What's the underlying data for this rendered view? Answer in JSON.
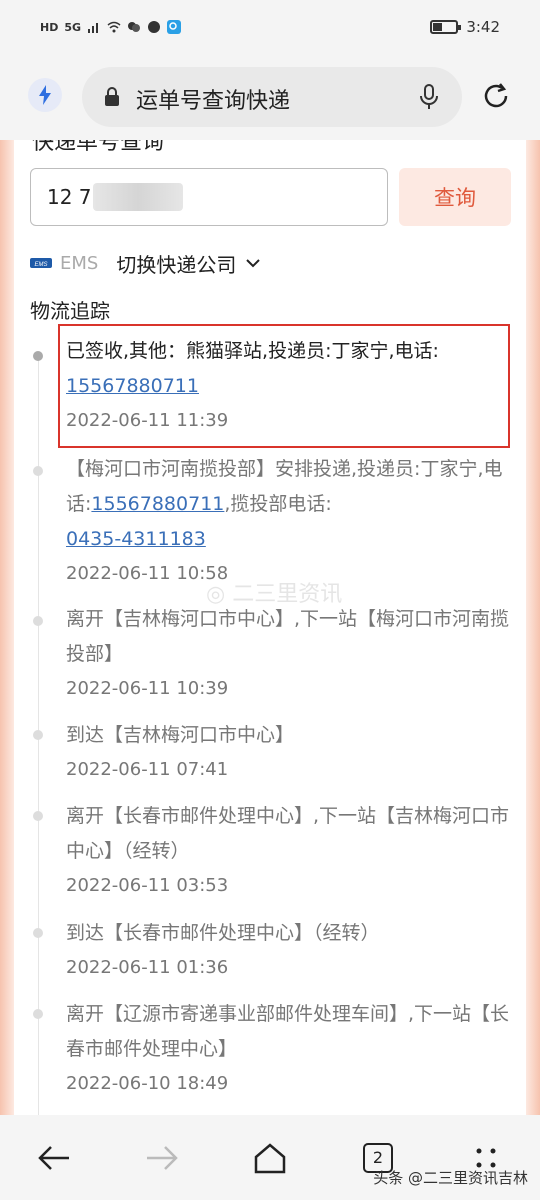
{
  "status_bar": {
    "network": "5G",
    "time": "3:42"
  },
  "browser": {
    "address_text": "运单号查询快递"
  },
  "page": {
    "cut_title": "快递单号查询",
    "tracking_number": "12        7760",
    "query_label": "查询",
    "carrier_name": "EMS",
    "carrier_logo_text": "EMS",
    "switch_carrier_label": "切换快递公司",
    "section_title": "物流追踪",
    "watermark": "◎ 二三里资讯"
  },
  "events": [
    {
      "text_before": "已签收,其他：熊猫驿站,投递员:丁家宁,电话:",
      "phone": "15567880711",
      "text_after": "",
      "time": "2022-06-11 11:39"
    },
    {
      "text_before": "【梅河口市河南揽投部】安排投递,投递员:丁家宁,电话:",
      "phone": "15567880711",
      "text_after": ",揽投部电话:",
      "phone2": "0435-4311183",
      "time": "2022-06-11 10:58"
    },
    {
      "text": "离开【吉林梅河口市中心】,下一站【梅河口市河南揽投部】",
      "time": "2022-06-11 10:39"
    },
    {
      "text": "到达【吉林梅河口市中心】",
      "time": "2022-06-11 07:41"
    },
    {
      "text": "离开【长春市邮件处理中心】,下一站【吉林梅河口市中心】（经转）",
      "time": "2022-06-11 03:53"
    },
    {
      "text": "到达【长春市邮件处理中心】（经转）",
      "time": "2022-06-11 01:36"
    },
    {
      "text": "离开【辽源市寄递事业部邮件处理车间】,下一站【长春市邮件处理中心】",
      "time": "2022-06-10 18:49"
    }
  ],
  "bottom_nav": {
    "tab_count": "2",
    "corner_mark": "头条 @二三里资讯吉林"
  },
  "colors": {
    "accent": "#e05a3d",
    "link": "#3a6fb8",
    "highlight_border": "#d9342b"
  }
}
